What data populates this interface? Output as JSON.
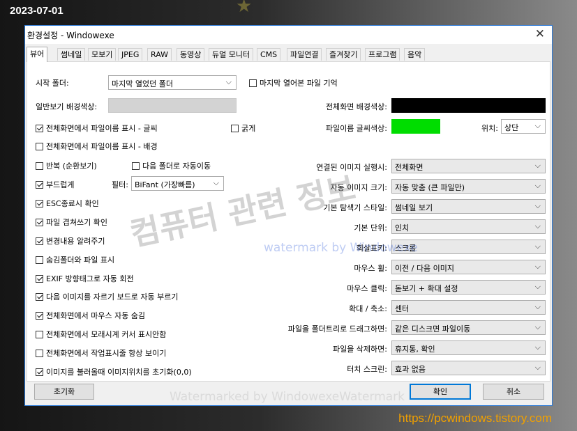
{
  "overlay": {
    "date": "2023-07-01",
    "url": "https://pcwindows.tistory.com",
    "watermark_big": "컴퓨터 관련 정보",
    "watermark_blue": "watermark by Windowexe",
    "watermark_bottom": "Watermarked by WindowexeWatermark"
  },
  "dialog": {
    "title": "환경설정 - Windowexe",
    "close_glyph": "✕"
  },
  "tabs": [
    "뷰어",
    "썸네일",
    "모보기",
    "JPEG",
    "RAW",
    "동영상",
    "듀얼 모니터",
    "CMS",
    "파일연결",
    "즐겨찾기",
    "프로그램",
    "음악"
  ],
  "left": {
    "start_folder_label": "시작 폴더:",
    "start_folder_value": "마지막 열었던 폴더",
    "remember_last_file": "마지막 열어본 파일 기억",
    "normal_bg_label": "일반보기 배경색상:",
    "show_filename_font": "전체화면에서 파일이름 표시 - 글씨",
    "bold": "굵게",
    "show_filename_bg": "전체화면에서 파일이름 표시 - 배경",
    "repeat": "반복 (순환보기)",
    "auto_next_folder": "다음 폴더로 자동이동",
    "smooth": "부드럽게",
    "filter_label": "필터:",
    "filter_value": "BiFant (가장빠름)",
    "esc_confirm": "ESC종료시 확인",
    "overwrite_confirm": "파일 겹쳐쓰기 확인",
    "notify_changes": "변경내용 알려주기",
    "show_hidden": "숨김폴더와 파일 표시",
    "exif_rotate": "EXIF 방향태그로 자동 회전",
    "crop_clipboard": "다음 이미지를 자르기 보드로 자동 부르기",
    "hide_mouse": "전체화면에서 마우스 자동 숨김",
    "hourglass": "전체화면에서 모래시계 커서 표시안함",
    "show_progress": "전체화면에서 작업표시줄 항상 보이기",
    "reset_position": "이미지를 불러올때 이미지위치를 초기화(0,0)"
  },
  "right": {
    "fullscreen_bg_label": "전체화면 배경색상:",
    "filename_color_label": "파일이름 글씨색상:",
    "position_label": "위치:",
    "position_value": "상단",
    "linked_image_label": "연결된 이미지 실행시:",
    "linked_image_value": "전체화면",
    "auto_size_label": "자동 이미지 크기:",
    "auto_size_value": "자동 맞춤 (큰 파일만)",
    "explorer_style_label": "기본 탐색기 스타일:",
    "explorer_style_value": "썸네일 보기",
    "unit_label": "기본 단위:",
    "unit_value": "인치",
    "wheel_label": "회살표키:",
    "wheel_value": "스크롤",
    "mouse_wheel_label": "마우스 휠:",
    "mouse_wheel_value": "이전 / 다음 이미지",
    "mouse_click_label": "마우스 클릭:",
    "mouse_click_value": "돋보기 + 확대 설정",
    "zoom_label": "확대 / 축소:",
    "zoom_value": "센터",
    "drag_label": "파일을 폴더트리로 드래그하면:",
    "drag_value": "같은 디스크면 파일이동",
    "delete_label": "파일을 삭제하면:",
    "delete_value": "휴지통, 확인",
    "touch_label": "터치 스크린:",
    "touch_value": "효과 없음"
  },
  "buttons": {
    "reset": "초기화",
    "ok": "확인",
    "cancel": "취소"
  },
  "icons": {
    "dropdown": "chevron-down-icon",
    "check": "checkmark-icon",
    "close": "close-icon"
  },
  "colors": {
    "accent": "#0078d7",
    "normal_bg": "#d3d3d3",
    "fullscreen_bg": "#000000",
    "filename_color": "#00dd00",
    "url_text": "#f0a000"
  },
  "check_states": {
    "remember_last_file": false,
    "show_filename_font": true,
    "bold": false,
    "show_filename_bg": false,
    "repeat": false,
    "auto_next_folder": false,
    "smooth": true,
    "esc_confirm": true,
    "overwrite_confirm": true,
    "notify_changes": true,
    "show_hidden": false,
    "exif_rotate": true,
    "crop_clipboard": true,
    "hide_mouse": true,
    "hourglass": false,
    "show_progress": false,
    "reset_position": true
  }
}
